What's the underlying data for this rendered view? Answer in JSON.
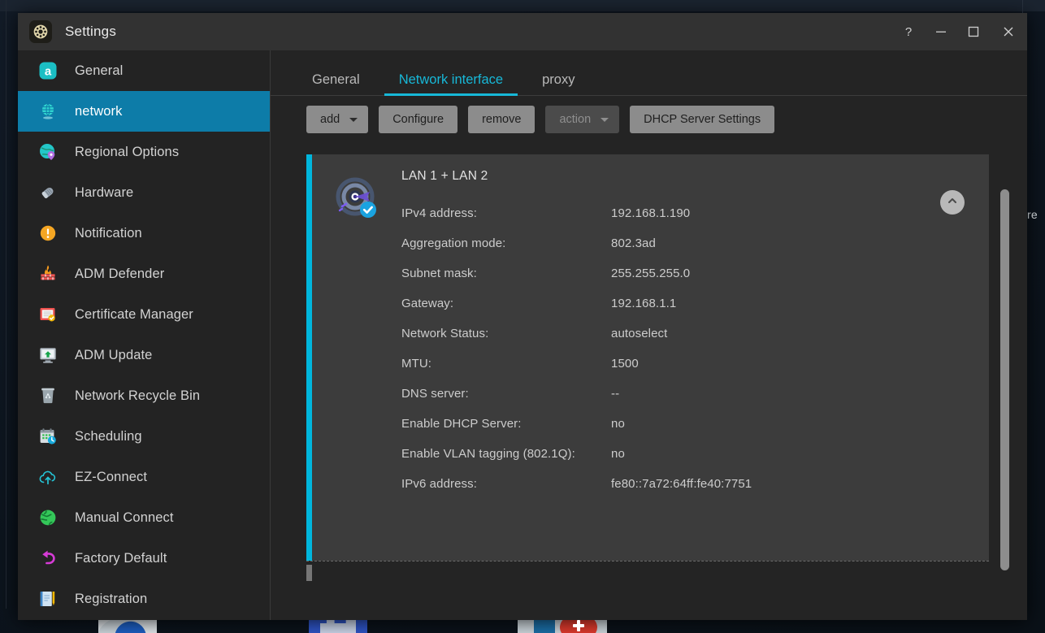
{
  "window": {
    "title": "Settings",
    "app_icon": "gear-icon",
    "controls": [
      {
        "name": "help-button",
        "glyph": "?"
      },
      {
        "name": "minimize-button",
        "glyph": "—"
      },
      {
        "name": "maximize-button",
        "glyph": "□"
      },
      {
        "name": "close-button",
        "glyph": "✕"
      }
    ]
  },
  "colors": {
    "accent_selected": "#0d7ca8",
    "accent_tab": "#17b8d8",
    "card_accent": "#00b6dd",
    "window_bg": "#242424",
    "card_bg": "#3c3c3c",
    "button_bg": "#8c8c8c",
    "button_disabled_bg": "#4b4b4b"
  },
  "sidebar": {
    "items": [
      {
        "label": "General",
        "icon": "adm-general-icon",
        "selected": false
      },
      {
        "label": "network",
        "icon": "globe-network-icon",
        "selected": true
      },
      {
        "label": "Regional Options",
        "icon": "globe-pin-icon",
        "selected": false
      },
      {
        "label": "Hardware",
        "icon": "hardware-chip-icon",
        "selected": false
      },
      {
        "label": "Notification",
        "icon": "notification-alert-icon",
        "selected": false
      },
      {
        "label": "ADM Defender",
        "icon": "firewall-icon",
        "selected": false
      },
      {
        "label": "Certificate Manager",
        "icon": "certificate-icon",
        "selected": false
      },
      {
        "label": "ADM Update",
        "icon": "update-monitor-icon",
        "selected": false
      },
      {
        "label": "Network Recycle Bin",
        "icon": "recycle-bin-icon",
        "selected": false
      },
      {
        "label": "Scheduling",
        "icon": "calendar-clock-icon",
        "selected": false
      },
      {
        "label": "EZ-Connect",
        "icon": "cloud-upload-icon",
        "selected": false
      },
      {
        "label": "Manual Connect",
        "icon": "globe-green-icon",
        "selected": false
      },
      {
        "label": "Factory Default",
        "icon": "undo-arrow-icon",
        "selected": false
      },
      {
        "label": "Registration",
        "icon": "registration-note-icon",
        "selected": false
      }
    ]
  },
  "tabs": [
    {
      "label": "General",
      "active": false
    },
    {
      "label": "Network interface",
      "active": true
    },
    {
      "label": "proxy",
      "active": false
    }
  ],
  "toolbar": {
    "buttons": [
      {
        "label": "add",
        "caret": true,
        "disabled": false,
        "name": "add-button"
      },
      {
        "label": "Configure",
        "caret": false,
        "disabled": false,
        "name": "configure-button"
      },
      {
        "label": "remove",
        "caret": false,
        "disabled": false,
        "name": "remove-button"
      },
      {
        "label": "action",
        "caret": true,
        "disabled": true,
        "name": "action-button"
      },
      {
        "label": "DHCP Server Settings",
        "caret": false,
        "disabled": false,
        "name": "dhcp-server-settings-button"
      }
    ]
  },
  "interface_card": {
    "title": "LAN 1 + LAN 2",
    "icon": "network-bond-connected-icon",
    "collapse_icon": "chevron-up-icon",
    "fields": [
      {
        "label": "IPv4 address:",
        "value": "192.168.1.190"
      },
      {
        "label": "Aggregation mode:",
        "value": "802.3ad"
      },
      {
        "label": "Subnet mask:",
        "value": "255.255.255.0"
      },
      {
        "label": "Gateway:",
        "value": "192.168.1.1"
      },
      {
        "label": "Network Status:",
        "value": "autoselect"
      },
      {
        "label": "MTU:",
        "value": "1500"
      },
      {
        "label": "DNS server:",
        "value": "--"
      },
      {
        "label": "Enable DHCP Server:",
        "value": "no"
      },
      {
        "label": "Enable VLAN tagging (802.1Q):",
        "value": "no"
      },
      {
        "label": "IPv6 address:",
        "value": "fe80::7a72:64ff:fe40:7751"
      }
    ]
  },
  "background": {
    "partial_text_right": "re"
  }
}
